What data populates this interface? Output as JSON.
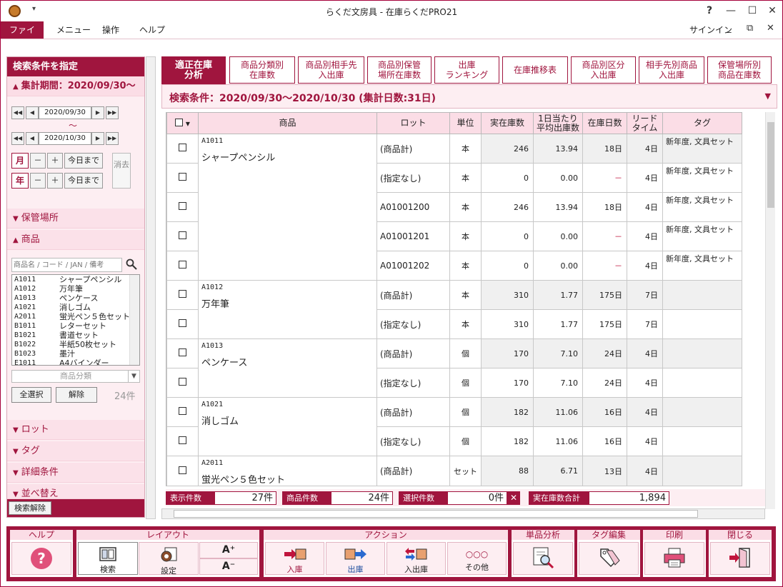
{
  "window": {
    "title": "らくだ文房具 - 在庫らくだPRO21",
    "help": "?",
    "quick_access": "▾",
    "minimize": "—",
    "maximize": "☐",
    "close": "✕"
  },
  "menubar": {
    "items": [
      "ファイル",
      "メニュー",
      "操作",
      "ヘルプ"
    ],
    "signin": "サインイン",
    "inner_min": "_",
    "inner_restore": "⧉",
    "inner_close": "✕"
  },
  "sidebar": {
    "header": "検索条件を指定",
    "period_label": "集計期間：2020/09/30～",
    "date_from": "2020/09/30",
    "date_to": "2020/10/30",
    "tilde": "～",
    "month_label": "月",
    "year_label": "年",
    "minus": "－",
    "plus": "＋",
    "today": "今日まで",
    "clear": "消去",
    "nav_first": "◀◀",
    "nav_prev": "◀",
    "nav_next": "▶",
    "nav_last": "▶▶",
    "sections": {
      "warehouse": "保管場所",
      "product": "商品",
      "lot": "ロット",
      "tag": "タグ",
      "detail": "詳細条件",
      "sort": "並べ替え"
    },
    "product_search_placeholder": "商品名 / コード / JAN / 備考",
    "product_list": [
      {
        "code": "A1011",
        "name": "シャープペンシル"
      },
      {
        "code": "A1012",
        "name": "万年筆"
      },
      {
        "code": "A1013",
        "name": "ペンケース"
      },
      {
        "code": "A1021",
        "name": "消しゴム"
      },
      {
        "code": "A2011",
        "name": "蛍光ペン５色セット"
      },
      {
        "code": "B1011",
        "name": "レターセット"
      },
      {
        "code": "B1021",
        "name": "書道セット"
      },
      {
        "code": "B1022",
        "name": "半紙50枚セット"
      },
      {
        "code": "B1023",
        "name": "墨汁"
      },
      {
        "code": "E1011",
        "name": "A4バインダー"
      }
    ],
    "category_placeholder": "商品分類",
    "select_all": "全選択",
    "deselect": "解除",
    "count": "24件",
    "search_clear": "検索解除"
  },
  "tabs": [
    {
      "label": "適正在庫\n分析",
      "active": true
    },
    {
      "label": "商品分類別\n在庫数"
    },
    {
      "label": "商品別相手先\n入出庫"
    },
    {
      "label": "商品別保管\n場所在庫数"
    },
    {
      "label": "出庫\nランキング"
    },
    {
      "label": "在庫推移表"
    },
    {
      "label": "商品別区分\n入出庫"
    },
    {
      "label": "相手先別商品\n入出庫"
    },
    {
      "label": "保管場所別\n商品在庫数"
    }
  ],
  "condition": {
    "text": "検索条件：2020/09/30～2020/10/30 (集計日数:31日)",
    "arrow": "▼"
  },
  "grid": {
    "header_check_arrow": "▾",
    "columns": [
      "商品",
      "ロット",
      "単位",
      "実在庫数",
      "1日当たり\n平均出庫数",
      "在庫日数",
      "リード\nタイム",
      "タグ"
    ],
    "groups": [
      {
        "code": "A1011",
        "name": "シャープペンシル",
        "rows": [
          {
            "lot": "(商品計)",
            "unit": "本",
            "stock": "246",
            "avg": "13.94",
            "days": "18日",
            "lead": "4日",
            "tag": "新年度, 文具セット"
          },
          {
            "lot": "(指定なし)",
            "unit": "本",
            "stock": "0",
            "avg": "0.00",
            "days": "－",
            "lead": "4日",
            "tag": "新年度, 文具セット"
          },
          {
            "lot": "A01001200",
            "unit": "本",
            "stock": "246",
            "avg": "13.94",
            "days": "18日",
            "lead": "4日",
            "tag": "新年度, 文具セット"
          },
          {
            "lot": "A01001201",
            "unit": "本",
            "stock": "0",
            "avg": "0.00",
            "days": "－",
            "lead": "4日",
            "tag": "新年度, 文具セット"
          },
          {
            "lot": "A01001202",
            "unit": "本",
            "stock": "0",
            "avg": "0.00",
            "days": "－",
            "lead": "4日",
            "tag": "新年度, 文具セット"
          }
        ]
      },
      {
        "code": "A1012",
        "name": "万年筆",
        "rows": [
          {
            "lot": "(商品計)",
            "unit": "本",
            "stock": "310",
            "avg": "1.77",
            "days": "175日",
            "lead": "7日",
            "tag": ""
          },
          {
            "lot": "(指定なし)",
            "unit": "本",
            "stock": "310",
            "avg": "1.77",
            "days": "175日",
            "lead": "7日",
            "tag": ""
          }
        ]
      },
      {
        "code": "A1013",
        "name": "ペンケース",
        "rows": [
          {
            "lot": "(商品計)",
            "unit": "個",
            "stock": "170",
            "avg": "7.10",
            "days": "24日",
            "lead": "4日",
            "tag": ""
          },
          {
            "lot": "(指定なし)",
            "unit": "個",
            "stock": "170",
            "avg": "7.10",
            "days": "24日",
            "lead": "4日",
            "tag": ""
          }
        ]
      },
      {
        "code": "A1021",
        "name": "消しゴム",
        "rows": [
          {
            "lot": "(商品計)",
            "unit": "個",
            "stock": "182",
            "avg": "11.06",
            "days": "16日",
            "lead": "4日",
            "tag": ""
          },
          {
            "lot": "(指定なし)",
            "unit": "個",
            "stock": "182",
            "avg": "11.06",
            "days": "16日",
            "lead": "4日",
            "tag": ""
          }
        ]
      },
      {
        "code": "A2011",
        "name": "蛍光ペン５色セット",
        "rows": [
          {
            "lot": "(商品計)",
            "unit": "セット",
            "stock": "88",
            "avg": "6.71",
            "days": "13日",
            "lead": "4日",
            "tag": ""
          }
        ]
      }
    ]
  },
  "footer": {
    "display_label": "表示件数",
    "display_value": "27件",
    "product_label": "商品件数",
    "product_value": "24件",
    "selected_label": "選択件数",
    "selected_value": "0件",
    "clear_x": "✕",
    "stock_label": "実在庫数合計",
    "stock_value": "1,894"
  },
  "toolbar": {
    "help_group": "ヘルプ",
    "layout_group": "レイアウト",
    "action_group": "アクション",
    "analysis_group": "単品分析",
    "tag_group": "タグ編集",
    "print_group": "印刷",
    "close_group": "閉じる",
    "search": "検索",
    "settings": "設定",
    "font_up": "A⁺",
    "font_down": "A⁻",
    "stock_in": "入庫",
    "stock_out": "出庫",
    "in_out": "入出庫",
    "other": "その他",
    "other_dots": "○○○"
  },
  "colors": {
    "accent": "#a0153e",
    "accent_light": "#fbdde6",
    "panel": "#fdeef2"
  }
}
